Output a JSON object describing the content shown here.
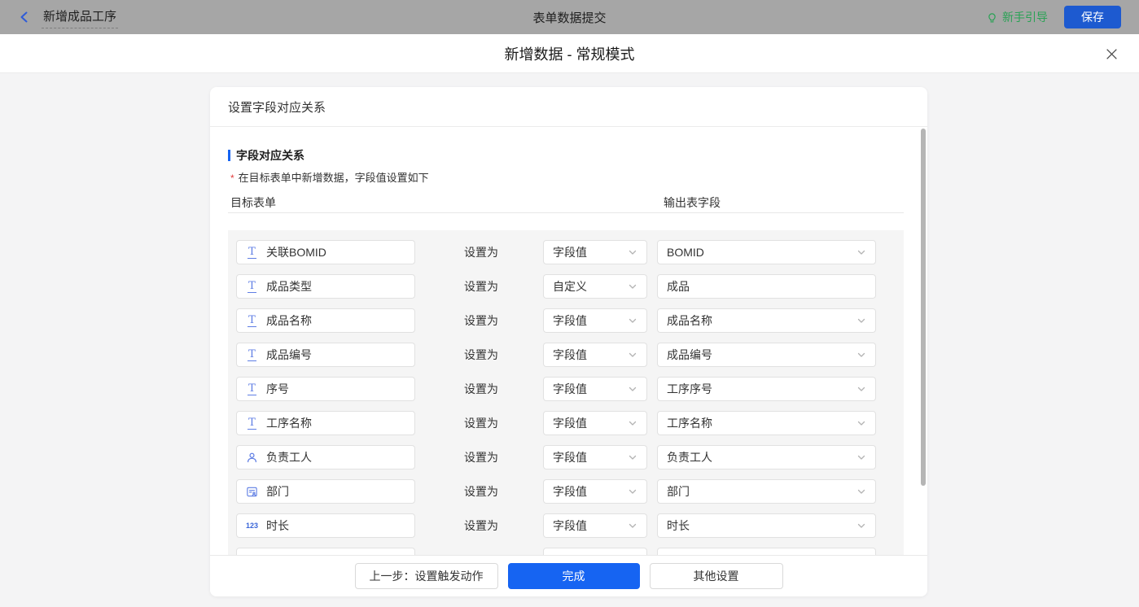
{
  "topbar": {
    "back_label": "新增成品工序",
    "title": "表单数据提交",
    "guide_label": "新手引导",
    "save_label": "保存"
  },
  "modal": {
    "title": "新增数据 - 常规模式"
  },
  "card": {
    "header": "设置字段对应关系",
    "section_title": "字段对应关系",
    "required_star": "*",
    "required_note": "在目标表单中新增数据，字段值设置如下",
    "col_left": "目标表单",
    "col_right": "输出表字段",
    "set_as_label": "设置为",
    "icons": {
      "text_glyph": "T",
      "number_glyph": "123"
    },
    "rows": [
      {
        "icon": "text",
        "field": "关联BOMID",
        "mode": "字段值",
        "value": "BOMID",
        "value_is_select": true
      },
      {
        "icon": "text",
        "field": "成品类型",
        "mode": "自定义",
        "value": "成品",
        "value_is_select": false
      },
      {
        "icon": "text",
        "field": "成品名称",
        "mode": "字段值",
        "value": "成品名称",
        "value_is_select": true
      },
      {
        "icon": "text",
        "field": "成品编号",
        "mode": "字段值",
        "value": "成品编号",
        "value_is_select": true
      },
      {
        "icon": "text",
        "field": "序号",
        "mode": "字段值",
        "value": "工序序号",
        "value_is_select": true
      },
      {
        "icon": "text",
        "field": "工序名称",
        "mode": "字段值",
        "value": "工序名称",
        "value_is_select": true
      },
      {
        "icon": "user",
        "field": "负责工人",
        "mode": "字段值",
        "value": "负责工人",
        "value_is_select": true
      },
      {
        "icon": "department",
        "field": "部门",
        "mode": "字段值",
        "value": "部门",
        "value_is_select": true
      },
      {
        "icon": "number",
        "field": "时长",
        "mode": "字段值",
        "value": "时长",
        "value_is_select": true
      },
      {
        "icon": "none",
        "field": "",
        "mode": "",
        "value": "",
        "value_is_select": true,
        "partial": true
      }
    ],
    "footer": {
      "prev_label": "上一步：设置触发动作",
      "done_label": "完成",
      "other_label": "其他设置"
    }
  },
  "colors": {
    "topbar_bg": "#a6a6a6",
    "accent_blue": "#1664f2",
    "save_blue": "#1d5ad0",
    "guide_green": "#2aa255",
    "field_icon_blue": "#5f7ee4",
    "required_red": "#e23c3c",
    "rows_panel_bg": "#f5f5f5"
  }
}
